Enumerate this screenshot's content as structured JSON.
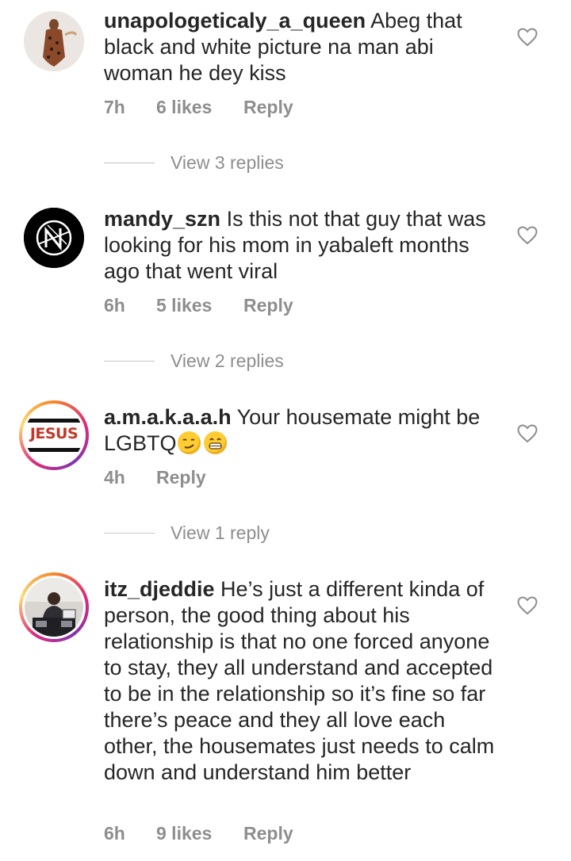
{
  "comments": [
    {
      "username": "unapologeticaly_a_queen",
      "text": "Abeg that black and white picture na man abi woman he dey kiss",
      "time": "7h",
      "likes": "6 likes",
      "reply_label": "Reply",
      "view_replies": "View 3 replies",
      "avatar": "woman-in-patterned-dress"
    },
    {
      "username": "mandy_szn",
      "text": "Is this not that guy that was looking for his mom in yabaleft months ago that went viral",
      "time": "6h",
      "likes": "5 likes",
      "reply_label": "Reply",
      "view_replies": "View 2 replies",
      "avatar": "black-logo"
    },
    {
      "username": "a.m.a.k.a.a.h",
      "text": "Your housemate might be LGBTQ",
      "emojis": [
        "smirking-face-emoji",
        "grinning-face-emoji"
      ],
      "time": "4h",
      "likes": "",
      "reply_label": "Reply",
      "view_replies": "View 1 reply",
      "avatar": "jesus-text",
      "avatar_text": "JESUS"
    },
    {
      "username": "itz_djeddie",
      "text": "He’s just a different kinda of person, the good thing about his relationship is that no one forced anyone to stay, they all understand and accepted to be in the relationship so it’s fine so far there’s peace and they all love each other, the housemates just needs to calm down and understand him better",
      "time": "6h",
      "likes": "9 likes",
      "reply_label": "Reply",
      "avatar": "dj-at-console"
    }
  ],
  "colors": {
    "text": "#262626",
    "secondary": "#8e8e8e",
    "story_ring": "#dd2a7b",
    "jesus_red": "#c0392b"
  },
  "icons": {
    "like": "heart-outline-icon"
  }
}
